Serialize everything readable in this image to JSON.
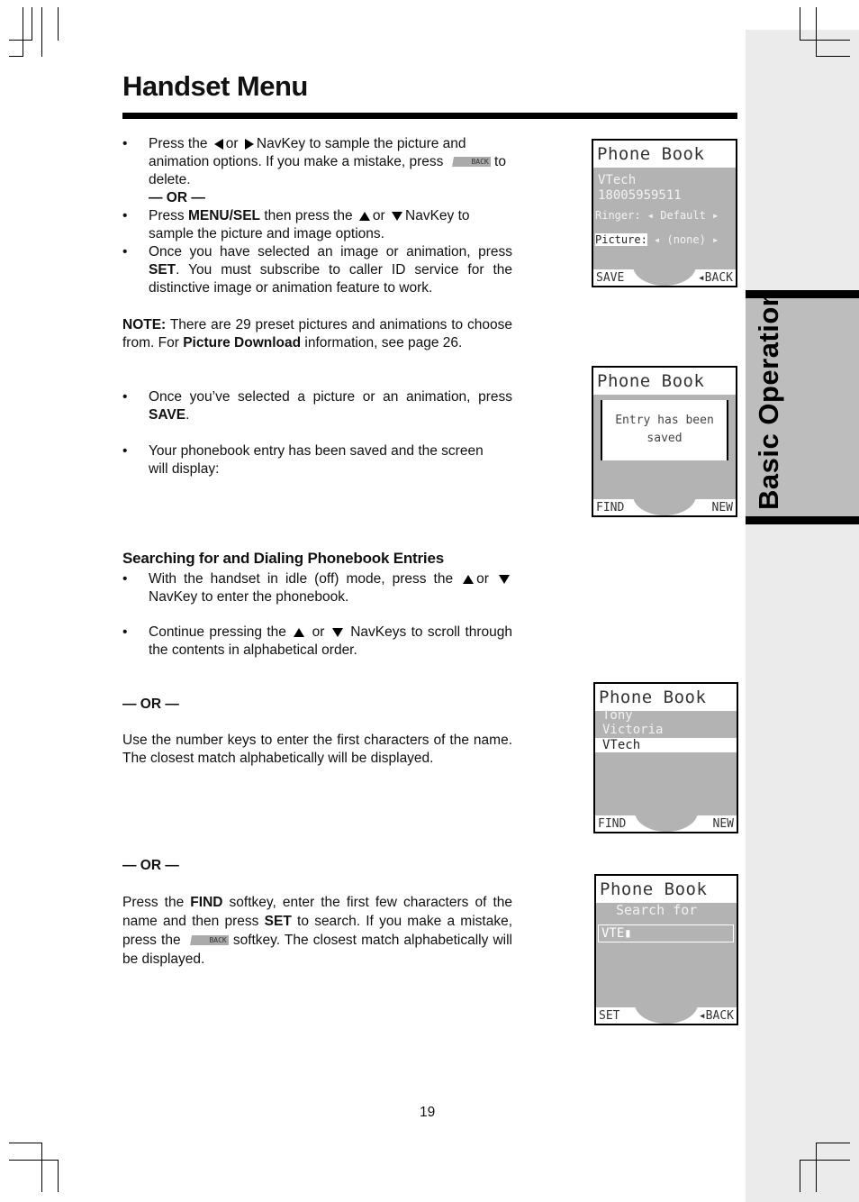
{
  "page": {
    "title": "Handset Menu",
    "side_tab": "Basic Operation",
    "page_number": "19"
  },
  "section1": {
    "bullet1_a": "Press the",
    "bullet1_or": "or",
    "bullet1_b": "NavKey to sample the picture and animation options. If you make a mistake, press",
    "bullet1_c": "to delete.",
    "or_divider": "— OR —",
    "bullet2_a": "Press",
    "bullet2_bold": "MENU/SEL",
    "bullet2_b": "then press the",
    "bullet2_or": "or",
    "bullet2_c": "NavKey to sample the picture and image options.",
    "bullet3_a": "Once you have selected an image or animation, press",
    "bullet3_bold": "SET",
    "bullet3_b": ". You must subscribe to caller ID service for the distinctive image or animation feature to work.",
    "note_label": "NOTE:",
    "note_a": "There are 29 preset pictures and  animations to choose from. For",
    "note_bold": "Picture Download",
    "note_b": "information, see page 26.",
    "bullet4_a": "Once you’ve selected a picture or an animation, press",
    "bullet4_bold": "SAVE",
    "bullet4_b": ".",
    "bullet5": "Your phonebook entry has been saved and the screen will display:"
  },
  "section2": {
    "heading": "Searching for and Dialing Phonebook Entries",
    "bullet1_a": "With the handset in idle (off) mode, press the",
    "bullet1_or": "or",
    "bullet1_b": "NavKey to enter the phonebook.",
    "bullet2_a": "Continue pressing the",
    "bullet2_or": "or",
    "bullet2_b": "NavKeys to scroll through the contents in alphabetical order.",
    "or1": "— OR —",
    "para1": "Use the number keys to enter the first characters of the name. The closest match alphabetically will be displayed.",
    "or2": "— OR —",
    "para2_a": "Press the",
    "para2_bold1": "FIND",
    "para2_b": "softkey, enter the first few characters of the name and then press",
    "para2_bold2": "SET",
    "para2_c": "to search. If you make a mistake, press the",
    "para2_d": "softkey. The closest match alphabetically will be displayed."
  },
  "backkey_label": "BACK",
  "screens": {
    "s1": {
      "header": "Phone Book",
      "name": "VTech",
      "number": "18005959511",
      "ringer": "Ringer: ◂ Default ▸",
      "picture_label": "Picture:",
      "picture_value": "◂ (none) ▸",
      "soft_left": "SAVE",
      "soft_right": "◂BACK"
    },
    "s2": {
      "header": "Phone Book",
      "message_line1": "Entry has been",
      "message_line2": "saved",
      "soft_left": "FIND",
      "soft_right": "NEW"
    },
    "s3": {
      "header": "Phone Book",
      "entries": [
        "Tony",
        "Victoria",
        "VTech"
      ],
      "selected": "VTech",
      "soft_left": "FIND",
      "soft_right": "NEW"
    },
    "s4": {
      "header": "Phone Book",
      "prompt": "Search for",
      "input": "VTE▮",
      "soft_left": "SET",
      "soft_right": "◂BACK"
    }
  }
}
